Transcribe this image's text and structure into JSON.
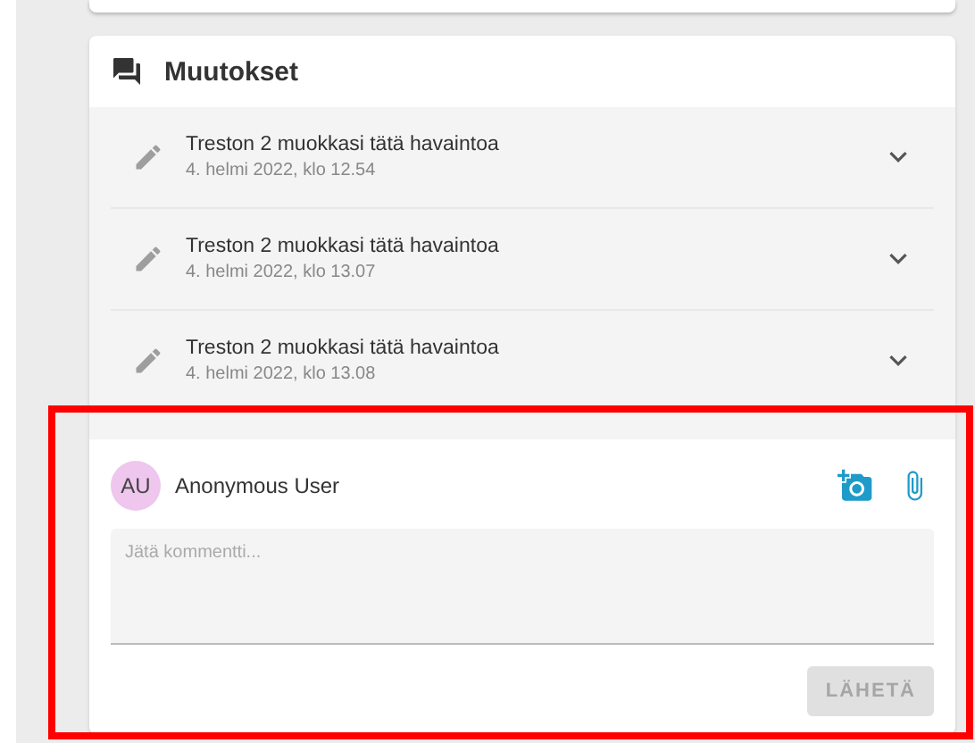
{
  "section": {
    "title": "Muutokset"
  },
  "changes": [
    {
      "title": "Treston 2 muokkasi tätä havaintoa",
      "date": "4. helmi 2022, klo 12.54",
      "expanded": false
    },
    {
      "title": "Treston 2 muokkasi tätä havaintoa",
      "date": "4. helmi 2022, klo 13.07",
      "expanded": false
    },
    {
      "title": "Treston 2 muokkasi tätä havaintoa",
      "date": "4. helmi 2022, klo 13.08",
      "expanded": false
    }
  ],
  "comment": {
    "avatar": "AU",
    "user": "Anonymous User",
    "placeholder": "Jätä kommentti...",
    "submit": {
      "label": "LÄHETÄ",
      "disabled": true
    }
  }
}
